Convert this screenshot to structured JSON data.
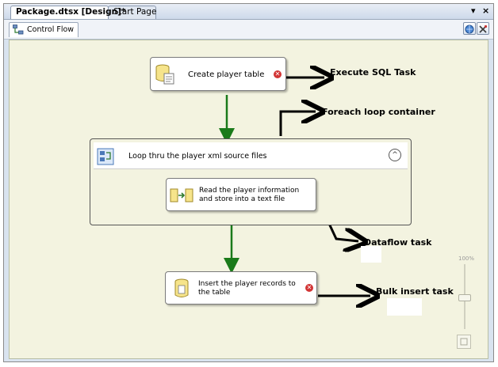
{
  "tabs": {
    "active": "Package.dtsx [Design]*",
    "inactive": "Start Page"
  },
  "window_controls": {
    "pin": "▾",
    "close": "×"
  },
  "subtab": {
    "label": "Control Flow"
  },
  "tasks": {
    "create_table": {
      "label": "Create player table"
    },
    "loop": {
      "label": "Loop thru the player xml source files",
      "collapse": "^"
    },
    "dataflow": {
      "label_line1": "Read the player information",
      "label_line2": "and store into a text file"
    },
    "bulk_insert": {
      "label_line1": "Insert the player records to",
      "label_line2": "the table"
    }
  },
  "callouts": {
    "execute_sql": "Execute SQL Task",
    "foreach": "Foreach loop container",
    "dataflow": "Dataflow task",
    "bulk_insert": "Bulk insert task"
  },
  "zoom": {
    "label": "100%"
  },
  "colors": {
    "canvas": "#f3f3e0",
    "precedence_arrow": "#1a7a1a",
    "error_icon": "#d23434"
  },
  "icons": {
    "control_flow_tab": "control-flow-icon",
    "create_table": "sql-task-icon",
    "loop": "foreach-container-icon",
    "dataflow": "dataflow-task-icon",
    "bulk_insert": "bulk-insert-icon",
    "error": "error-icon"
  }
}
